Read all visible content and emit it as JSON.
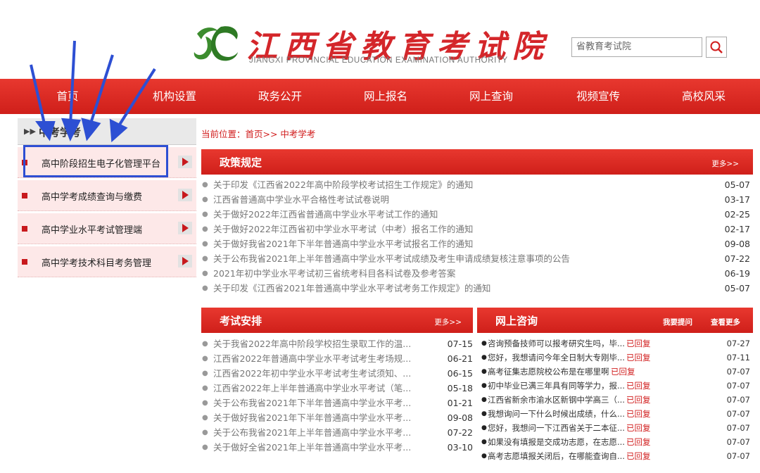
{
  "header": {
    "title": "江西省教育考试院",
    "subtitle": "JIANGXI PROVINCIAL EDUCATION EXAMINATION AUTHORITY",
    "search_value": "省教育考试院",
    "search_icon": "search-icon"
  },
  "nav": [
    "首页",
    "机构设置",
    "政务公开",
    "网上报名",
    "网上查询",
    "视频宣传",
    "高校风采"
  ],
  "sidebar": {
    "title": "中考学考",
    "items": [
      "高中阶段招生电子化管理平台",
      "高中学考成绩查询与缴费",
      "高中学业水平考试管理端",
      "高中学考技术科目考务管理"
    ]
  },
  "breadcrumb": "当前位置：首页>> 中考学考",
  "policy": {
    "title": "政策规定",
    "more": "更多>>",
    "items": [
      {
        "text": "关于印发《江西省2022年高中阶段学校考试招生工作规定》的通知",
        "date": "05-07"
      },
      {
        "text": "江西省普通高中学业水平合格性考试试卷说明",
        "date": "03-17"
      },
      {
        "text": "关于做好2022年江西省普通高中学业水平考试工作的通知",
        "date": "02-25"
      },
      {
        "text": "关于做好2022年江西省初中学业水平考试（中考）报名工作的通知",
        "date": "02-17"
      },
      {
        "text": "关于做好我省2021年下半年普通高中学业水平考试报名工作的通知",
        "date": "09-08"
      },
      {
        "text": "关于公布我省2021年上半年普通高中学业水平考试成绩及考生申请成绩复核注意事项的公告",
        "date": "07-22"
      },
      {
        "text": "2021年初中学业水平考试初三省统考科目各科试卷及参考答案",
        "date": "06-19"
      },
      {
        "text": "关于印发《江西省2021年普通高中学业水平考试考务工作规定》的通知",
        "date": "05-07"
      }
    ]
  },
  "exam": {
    "title": "考试安排",
    "more": "更多>>",
    "items": [
      {
        "text": "关于我省2022年高中阶段学校招生录取工作的温...",
        "date": "07-15"
      },
      {
        "text": "江西省2022年普通高中学业水平考试考生考场规...",
        "date": "06-21"
      },
      {
        "text": "江西省2022年初中学业水平考试考生考试须知、...",
        "date": "06-15"
      },
      {
        "text": "江西省2022年上半年普通高中学业水平考试（笔...",
        "date": "05-18"
      },
      {
        "text": "关于公布我省2021年下半年普通高中学业水平考...",
        "date": "01-21"
      },
      {
        "text": "关于做好我省2021年下半年普通高中学业水平考...",
        "date": "09-08"
      },
      {
        "text": "关于公布我省2021年上半年普通高中学业水平考...",
        "date": "07-22"
      },
      {
        "text": "关于做好全省2021年上半年普通高中学业水平考...",
        "date": "03-10"
      }
    ]
  },
  "consult": {
    "title": "网上咨询",
    "ask": "我要提问",
    "more": "查看更多",
    "items": [
      {
        "text": "咨询预备技师可以报考研究生吗，毕...",
        "reply": "已回复",
        "date": "07-27"
      },
      {
        "text": "您好，我想请问今年全日制大专刚毕...",
        "reply": "已回复",
        "date": "07-11"
      },
      {
        "text": "高考征集志愿院校公布是在哪里啊",
        "reply": "已回复",
        "date": "07-07"
      },
      {
        "text": "初中毕业已满三年具有同等学力，报...",
        "reply": "已回复",
        "date": "07-07"
      },
      {
        "text": "江西省新余市渝水区新钢中学高三（...",
        "reply": "已回复",
        "date": "07-07"
      },
      {
        "text": "我想询问一下什么时候出成绩，什么...",
        "reply": "已回复",
        "date": "07-07"
      },
      {
        "text": "您好，我想问一下江西省关于二本征...",
        "reply": "已回复",
        "date": "07-07"
      },
      {
        "text": "如果没有填报是交成功志愿，在志愿...",
        "reply": "已回复",
        "date": "07-07"
      },
      {
        "text": "高考志愿填报关闭后，在哪能查询自...",
        "reply": "已回复",
        "date": "07-07"
      }
    ]
  },
  "colors": {
    "brand_red": "#d4262a",
    "nav_red": "#e8382f",
    "annotation_blue": "#2d4fd3"
  }
}
